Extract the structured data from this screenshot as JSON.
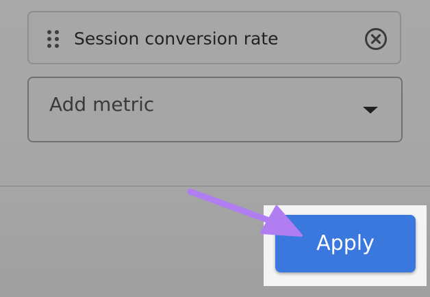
{
  "metrics": {
    "selected": [
      {
        "label": "Session conversion rate",
        "drag_icon": "drag-handle-icon",
        "remove_icon": "cancel-circle-icon"
      }
    ],
    "add_placeholder": "Add metric",
    "dropdown_icon": "arrow-drop-down-icon"
  },
  "footer": {
    "apply_label": "Apply"
  },
  "annotation": {
    "icon": "pointer-arrow-icon",
    "color": "#b07ef0"
  },
  "colors": {
    "apply_button": "#3a78de",
    "overlay_background": "#a6a6a6",
    "highlight_background": "#f4f4f4"
  }
}
